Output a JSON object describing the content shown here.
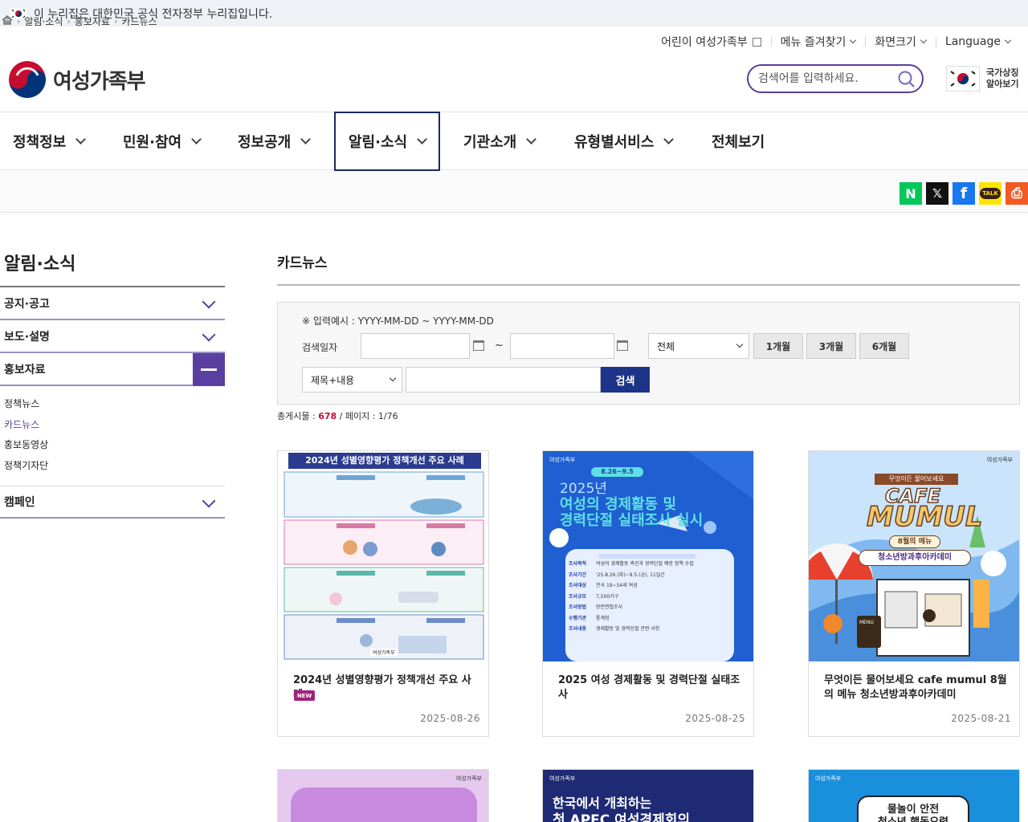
{
  "gov_banner": {
    "text": "이 누리집은 대한민국 공식 전자정부 누리집입니다."
  },
  "utility": [
    {
      "label": "어린이 여성가족부",
      "icon": "external-link-icon"
    },
    {
      "label": "메뉴 즐겨찾기",
      "icon": "chevron-down-icon"
    },
    {
      "label": "화면크기",
      "icon": "chevron-down-icon"
    },
    {
      "label": "Language",
      "icon": "chevron-down-icon"
    }
  ],
  "logo": {
    "name": "여성가족부"
  },
  "search": {
    "placeholder": "검색어를 입력하세요."
  },
  "national_symbol": {
    "line1": "국가상징",
    "line2": "알아보기"
  },
  "gnb": [
    "정책정보",
    "민원·참여",
    "정보공개",
    "알림·소식",
    "기관소개",
    "유형별서비스",
    "전체보기"
  ],
  "breadcrumb": [
    "알림·소식",
    "홍보자료",
    "카드뉴스"
  ],
  "share": [
    {
      "name": "naver-blog",
      "glyph": "N",
      "color": "#03c75a"
    },
    {
      "name": "x",
      "glyph": "𝕏",
      "color": "#111111"
    },
    {
      "name": "facebook",
      "glyph": "f",
      "color": "#1877f2"
    },
    {
      "name": "kakaotalk",
      "glyph": "TALK",
      "color": "#fee500"
    },
    {
      "name": "print",
      "glyph": "⎙",
      "color": "#f15a24"
    }
  ],
  "lnb": {
    "title": "알림·소식",
    "items": [
      "공지·공고",
      "보도·설명",
      "홍보자료",
      "캠페인"
    ],
    "sub": [
      "정책뉴스",
      "카드뉴스",
      "홍보동영상",
      "정책기자단"
    ],
    "active_sub": "카드뉴스"
  },
  "main": {
    "title": "카드뉴스",
    "hint": "※ 입력예시 : YYYY-MM-DD ~ YYYY-MM-DD",
    "date_label": "검색일자",
    "tilde": "~",
    "scope": "전체",
    "periods": [
      "1개월",
      "3개월",
      "6개월"
    ],
    "field": "제목+내용",
    "search_button": "검색",
    "count_prefix": "총게시물 : ",
    "count": "678",
    "count_suffix": " / 페이지 : 1/76"
  },
  "cards": [
    {
      "title": "2024년 성별영향평가 정책개선 주요 사례",
      "date": "2025-08-26",
      "new": "NEW",
      "thumb_heading": "2024년 성별영향평가 정책개선 주요 사례"
    },
    {
      "title": "2025 여성 경제활동 및 경력단절 실태조사",
      "date": "2025-08-25",
      "thumb_date": "8.26~9.5",
      "thumb_year": "2025년",
      "thumb_line1": "여성의 경제활동 및",
      "thumb_line2": "경력단절 실태조사 실시",
      "thumb_rows": [
        [
          "조사목적",
          "여성의 경제활동 촉진과 경력단절 예방 정책 수립"
        ],
        [
          "조사기간",
          "'25.8.26.(화)~9.5.(금), 11일간"
        ],
        [
          "조사대상",
          "전국 19~54세 여성"
        ],
        [
          "조사규모",
          "7,500가구"
        ],
        [
          "조사방법",
          "방문면접조사"
        ],
        [
          "수행기관",
          "통계청"
        ],
        [
          "조사내용",
          "경제활동 및 경력단절 관련 사항"
        ]
      ]
    },
    {
      "title": "무엇이든 물어보세요 cafe mumul 8월의 메뉴 청소년방과후아카데미",
      "date": "2025-08-21",
      "thumb_top": "무엇이든 물어보세요",
      "thumb_cafe": "CAFE",
      "thumb_mumul": "MUMUL",
      "thumb_menu": "8월의 메뉴",
      "thumb_sub": "청소년방과후아카데미",
      "thumb_sign": "MENU"
    }
  ],
  "cards_row2": [
    {
      "thumb_line1": "",
      "thumb_line2": ""
    },
    {
      "thumb_line1": "한국에서 개최하는",
      "thumb_line2": "첫 APEC 여성경제회의"
    },
    {
      "thumb_line1": "물놀이 안전",
      "thumb_line2": "청소년 행동요령"
    }
  ],
  "brand_mark": "여성가족부",
  "colors": {
    "primary": "#5a3fa0",
    "navy": "#1d3488",
    "count_red": "#c8102e"
  }
}
